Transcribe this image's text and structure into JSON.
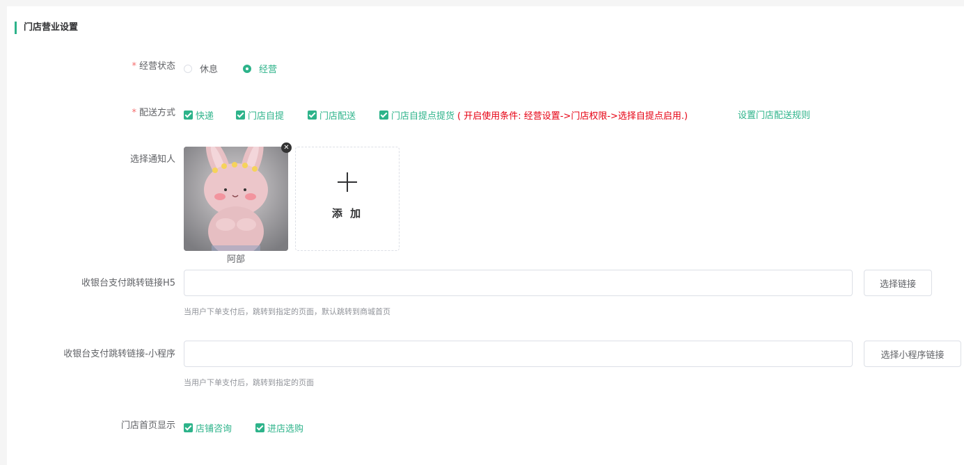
{
  "section": {
    "title": "门店营业设置"
  },
  "business_status": {
    "required_mark": "*",
    "label": "经营状态",
    "options": [
      {
        "label": "休息",
        "selected": false
      },
      {
        "label": "经营",
        "selected": true
      }
    ]
  },
  "delivery": {
    "required_mark": "*",
    "label": "配送方式",
    "options": [
      {
        "label": "快递",
        "checked": true
      },
      {
        "label": "门店自提",
        "checked": true
      },
      {
        "label": "门店配送",
        "checked": true
      },
      {
        "label": "门店自提点提货",
        "checked": true
      }
    ],
    "condition_note": "( 开启使用条件: 经营设置->门店权限->选择自提点启用.)",
    "rule_link": "设置门店配送规则"
  },
  "notifier": {
    "label": "选择通知人",
    "person_name": "阿部",
    "remove_icon": "close-circle-icon",
    "add_label": "添 加",
    "add_icon": "plus-icon"
  },
  "h5_link": {
    "label": "收银台支付跳转链接H5",
    "value": "",
    "button": "选择链接",
    "tip": "当用户下单支付后，跳转到指定的页面，默认跳转到商城首页"
  },
  "mini_link": {
    "label": "收银台支付跳转链接-小程序",
    "value": "",
    "button": "选择小程序链接",
    "tip": "当用户下单支付后，跳转到指定的页面"
  },
  "homepage_display": {
    "label": "门店首页显示",
    "options": [
      {
        "label": "店铺咨询",
        "checked": true
      },
      {
        "label": "进店选购",
        "checked": true
      }
    ]
  },
  "colors": {
    "accent": "#2db38a",
    "warning": "#e60012",
    "required": "#f56c6c"
  }
}
